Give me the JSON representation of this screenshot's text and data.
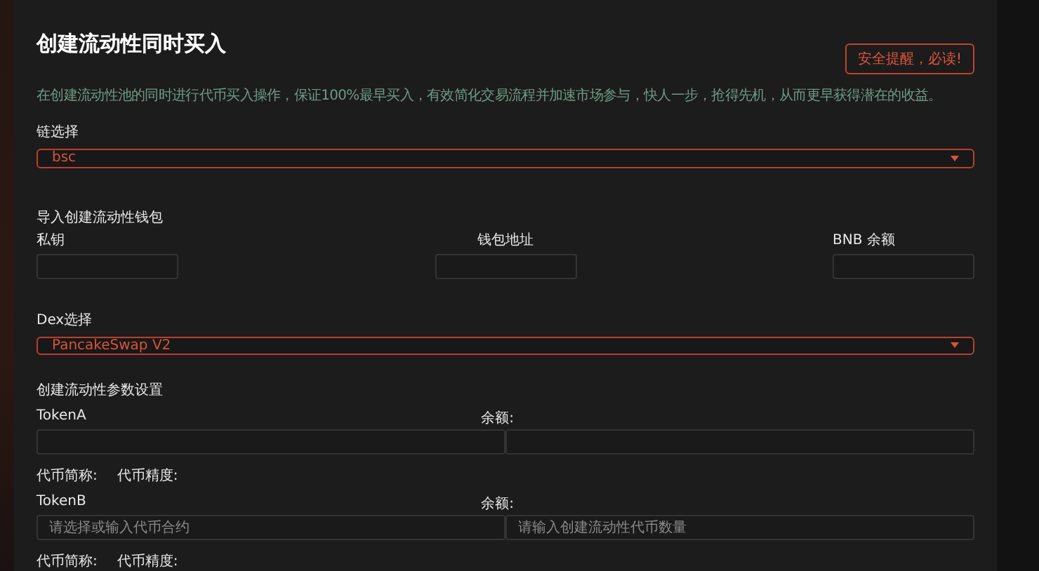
{
  "title": "创建流动性同时买入",
  "alert_button": "安全提醒，必读!",
  "description": "在创建流动性池的同时进行代币买入操作，保证100%最早买入，有效简化交易流程并加速市场参与，快人一步，抢得先机，从而更早获得潜在的收益。",
  "chain": {
    "label": "链选择",
    "value": "bsc"
  },
  "wallet": {
    "heading": "导入创建流动性钱包",
    "fields": [
      {
        "label": "私钥"
      },
      {
        "label": "钱包地址"
      },
      {
        "label": "BNB 余额"
      }
    ]
  },
  "dex": {
    "label": "Dex选择",
    "value": "PancakeSwap V2"
  },
  "params": {
    "heading": "创建流动性参数设置",
    "tokens": [
      {
        "label": "TokenA",
        "balance_label": "余额:",
        "symbol_label": "代币简称:",
        "decimals_label": "代币精度:"
      },
      {
        "label": "TokenB",
        "balance_label": "余额:",
        "contract_placeholder": "请选择或输入代币合约",
        "amount_placeholder": "请输入创建流动性代币数量",
        "symbol_label": "代币简称:",
        "decimals_label": "代币精度:"
      }
    ]
  }
}
